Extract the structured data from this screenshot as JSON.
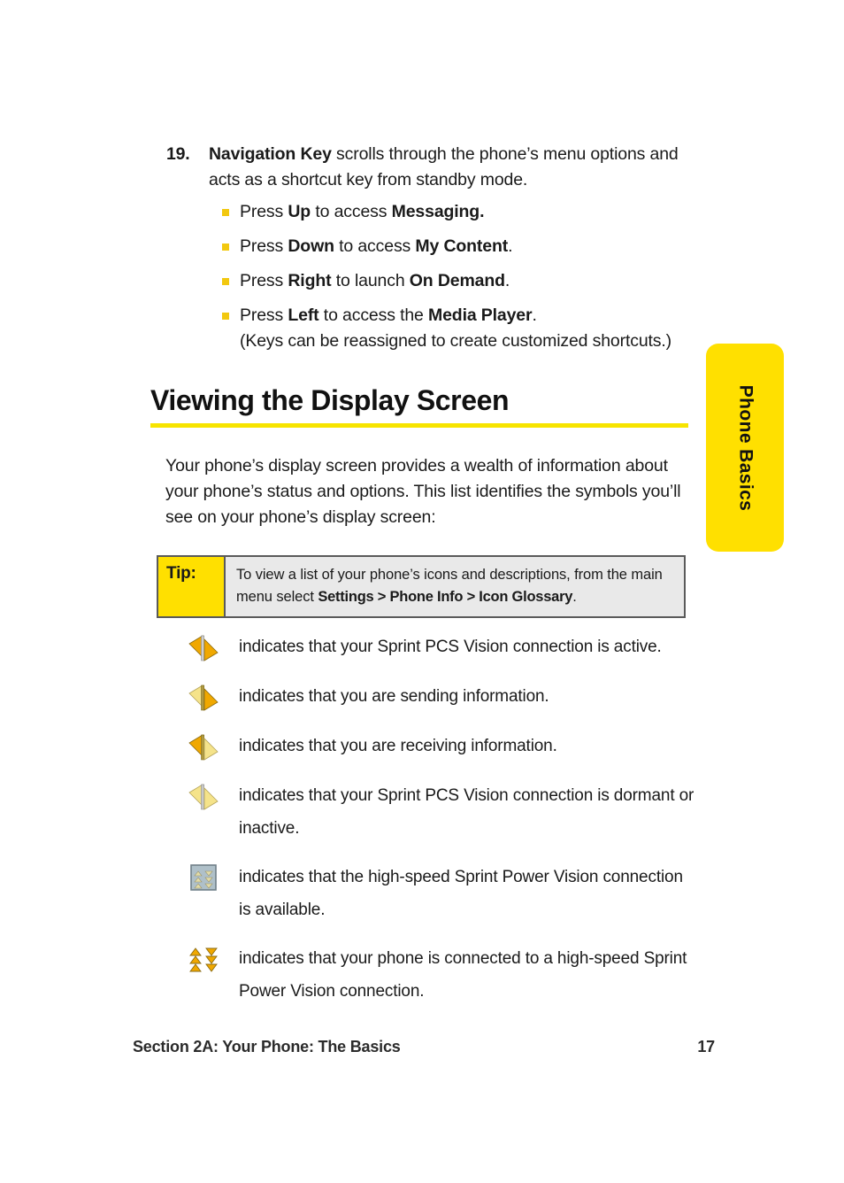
{
  "numbered_item": {
    "number": "19.",
    "lead_bold": "Navigation Key",
    "lead_rest": " scrolls through the phone’s menu options and acts as a shortcut key from standby mode.",
    "sub_items": [
      {
        "prefix": "Press ",
        "key": "Up",
        "middle": " to access ",
        "target": "Messaging.",
        "suffix": "",
        "continuation": ""
      },
      {
        "prefix": "Press ",
        "key": "Down",
        "middle": " to access ",
        "target": "My Content",
        "suffix": ".",
        "continuation": ""
      },
      {
        "prefix": "Press ",
        "key": "Right",
        "middle": " to launch ",
        "target": "On Demand",
        "suffix": ".",
        "continuation": ""
      },
      {
        "prefix": "Press ",
        "key": "Left",
        "middle": " to access the ",
        "target": "Media Player",
        "suffix": ".",
        "continuation": "(Keys can be reassigned to create customized shortcuts.)"
      }
    ]
  },
  "section": {
    "heading": "Viewing the Display Screen",
    "rule_color": "#F7E400",
    "intro": "Your phone’s display screen provides a wealth of information about your phone’s status and options. This list identifies the symbols you’ll see on your phone’s display screen:"
  },
  "tip": {
    "label": "Tip:",
    "text_before": "To view a list of your phone’s icons and descriptions, from the main menu select ",
    "path_bold": "Settings > Phone Info > Icon Glossary",
    "text_after": ".",
    "label_bg": "#FFE000",
    "body_bg": "#E9E9E9",
    "border_color": "#5A5A5A"
  },
  "icon_list": [
    {
      "icon": "vision-connection-active-icon",
      "description": "indicates that your Sprint PCS Vision connection is active."
    },
    {
      "icon": "vision-sending-icon",
      "description": "indicates that you are sending information."
    },
    {
      "icon": "vision-receiving-icon",
      "description": "indicates that you are receiving information."
    },
    {
      "icon": "vision-dormant-icon",
      "description": "indicates that your Sprint PCS Vision connection is dormant or inactive."
    },
    {
      "icon": "power-vision-available-icon",
      "description": "indicates that the high-speed Sprint Power Vision connection is available."
    },
    {
      "icon": "power-vision-connected-icon",
      "description": "indicates that your phone is connected to a high-speed Sprint Power Vision connection."
    }
  ],
  "footer": {
    "section_label": "Section 2A: Your Phone: The Basics",
    "page_number": "17"
  },
  "side_tab": {
    "label": "Phone Basics",
    "color": "#FFE000"
  },
  "colors": {
    "bullet": "#F2C80F",
    "icon_orange": "#F0A800",
    "icon_pale": "#F5E38A",
    "icon_gray_box": "#A9B4BE"
  }
}
